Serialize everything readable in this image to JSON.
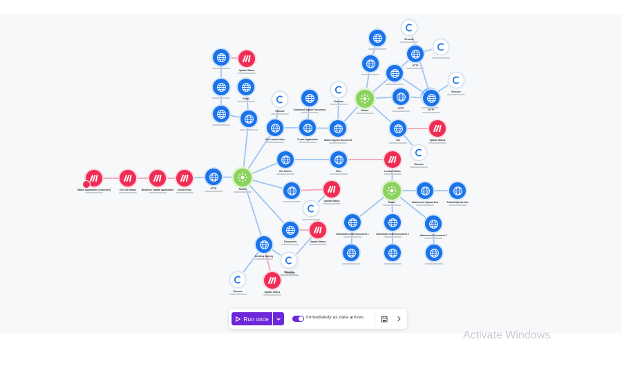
{
  "toolbar": {
    "run_label": "Run once",
    "schedule_label": "Immediately as data arrives",
    "schedule_on": true,
    "accent_color": "#6d28d9"
  },
  "watermark": "Activate Windows",
  "colors": {
    "http_module": "#1a73e8",
    "make_module": "#ef2e55",
    "router_module": "#8cd25f",
    "resume_module": "#ffffff"
  },
  "nodes": [
    {
      "id": "trigger",
      "type": "make",
      "label": "Watch Application (Searched)",
      "icon": "make-logo-icon"
    },
    {
      "id": "get_job",
      "type": "make",
      "label": "Get Job Status",
      "icon": "make-logo-icon"
    },
    {
      "id": "business",
      "type": "make",
      "label": "Business Capital Application",
      "icon": "make-logo-icon"
    },
    {
      "id": "create_entry",
      "type": "make",
      "label": "Create Entry",
      "icon": "make-logo-icon"
    },
    {
      "id": "http_main",
      "type": "http",
      "label": "HTTP",
      "icon": "globe-icon"
    },
    {
      "id": "router_main",
      "type": "router",
      "label": "Router",
      "icon": "router-icon"
    },
    {
      "id": "h1",
      "type": "http",
      "label": "",
      "icon": "globe-icon"
    },
    {
      "id": "upd1",
      "type": "make",
      "label": "Update Status",
      "icon": "make-logo-icon"
    },
    {
      "id": "h2",
      "type": "http",
      "label": "",
      "icon": "globe-icon"
    },
    {
      "id": "h3",
      "type": "http",
      "label": "Email",
      "icon": "globe-icon"
    },
    {
      "id": "h4",
      "type": "http",
      "label": "",
      "icon": "globe-icon"
    },
    {
      "id": "h5",
      "type": "http",
      "label": "",
      "icon": "globe-icon"
    },
    {
      "id": "res1",
      "type": "resume",
      "label": "Resume",
      "icon": "resume-icon"
    },
    {
      "id": "h6",
      "type": "http",
      "label": "Download Signed Document",
      "icon": "globe-icon"
    },
    {
      "id": "res2",
      "type": "resume",
      "label": "Resume",
      "icon": "resume-icon"
    },
    {
      "id": "h7",
      "type": "http",
      "label": "Get Lowest Value",
      "icon": "globe-icon"
    },
    {
      "id": "h8",
      "type": "http",
      "label": "Create Application",
      "icon": "globe-icon"
    },
    {
      "id": "h9",
      "type": "http",
      "label": "Attach Signed Document",
      "icon": "globe-icon"
    },
    {
      "id": "router_top",
      "type": "router",
      "label": "Router",
      "icon": "router-icon"
    },
    {
      "id": "h10",
      "type": "http",
      "label": "",
      "icon": "globe-icon"
    },
    {
      "id": "h11",
      "type": "http",
      "label": "",
      "icon": "globe-icon"
    },
    {
      "id": "res3",
      "type": "resume",
      "label": "",
      "icon": "resume-icon"
    },
    {
      "id": "h12",
      "type": "http",
      "label": "HTTP",
      "icon": "globe-icon"
    },
    {
      "id": "res4",
      "type": "resume",
      "label": "Resume",
      "icon": "resume-icon"
    },
    {
      "id": "h13",
      "type": "http",
      "label": "",
      "icon": "globe-icon"
    },
    {
      "id": "h14",
      "type": "http",
      "label": "",
      "icon": "globe-icon"
    },
    {
      "id": "h15",
      "type": "http",
      "label": "HTTP",
      "icon": "globe-icon"
    },
    {
      "id": "h16",
      "type": "http",
      "label": "HTTP",
      "icon": "globe-icon"
    },
    {
      "id": "res5",
      "type": "resume",
      "label": "Resume",
      "icon": "resume-icon"
    },
    {
      "id": "h17",
      "type": "http",
      "label": "Get",
      "icon": "globe-icon"
    },
    {
      "id": "upd2",
      "type": "make",
      "label": "Update Status",
      "icon": "make-logo-icon"
    },
    {
      "id": "res6",
      "type": "resume",
      "label": "Resume",
      "icon": "resume-icon"
    },
    {
      "id": "h18",
      "type": "http",
      "label": "Get Tokens",
      "icon": "globe-icon"
    },
    {
      "id": "h19",
      "type": "http",
      "label": "Files",
      "icon": "globe-icon"
    },
    {
      "id": "lookup",
      "type": "make",
      "label": "Lookup Status",
      "icon": "make-logo-icon"
    },
    {
      "id": "h20",
      "type": "http",
      "label": "",
      "icon": "globe-icon"
    },
    {
      "id": "upd3",
      "type": "make",
      "label": "Update Status",
      "icon": "make-logo-icon"
    },
    {
      "id": "res7",
      "type": "resume",
      "label": "",
      "icon": "resume-icon"
    },
    {
      "id": "router_mid",
      "type": "router",
      "label": "Router",
      "icon": "router-icon"
    },
    {
      "id": "h21",
      "type": "http",
      "label": "Attachment Upload Doc",
      "icon": "globe-icon"
    },
    {
      "id": "h22",
      "type": "http",
      "label": "Submit Upload Doc",
      "icon": "globe-icon"
    },
    {
      "id": "h23",
      "type": "http",
      "label": "Download Credit Document 1",
      "icon": "globe-icon"
    },
    {
      "id": "h24",
      "type": "http",
      "label": "Download Credit Document 2",
      "icon": "globe-icon"
    },
    {
      "id": "h25",
      "type": "http",
      "label": "Attachment Document 3",
      "icon": "globe-icon"
    },
    {
      "id": "h26",
      "type": "http",
      "label": "",
      "icon": "globe-icon"
    },
    {
      "id": "h27",
      "type": "http",
      "label": "",
      "icon": "globe-icon"
    },
    {
      "id": "h28",
      "type": "http",
      "label": "",
      "icon": "globe-icon"
    },
    {
      "id": "h29",
      "type": "http",
      "label": "Documents",
      "icon": "globe-icon"
    },
    {
      "id": "upd4",
      "type": "make",
      "label": "Update Status",
      "icon": "make-logo-icon"
    },
    {
      "id": "res8",
      "type": "resume",
      "label": "Resume",
      "icon": "resume-icon"
    },
    {
      "id": "h30",
      "type": "http",
      "label": "Sending Agency",
      "icon": "globe-icon"
    },
    {
      "id": "res9",
      "type": "resume",
      "label": "Resume",
      "icon": "resume-icon"
    },
    {
      "id": "res10",
      "type": "resume",
      "label": "Resume",
      "icon": "resume-icon"
    },
    {
      "id": "upd5",
      "type": "make",
      "label": "Update Status",
      "icon": "make-logo-icon"
    }
  ],
  "edges": [
    [
      "trigger",
      "get_job"
    ],
    [
      "get_job",
      "business"
    ],
    [
      "business",
      "create_entry"
    ],
    [
      "create_entry",
      "http_main"
    ],
    [
      "http_main",
      "router_main"
    ],
    [
      "h1",
      "upd1"
    ],
    [
      "h1",
      "h2"
    ],
    [
      "h2",
      "h4"
    ],
    [
      "h4",
      "h5"
    ],
    [
      "h3",
      "h5"
    ],
    [
      "h5",
      "router_main"
    ],
    [
      "router_main",
      "h7"
    ],
    [
      "h7",
      "h8"
    ],
    [
      "h8",
      "h9"
    ],
    [
      "h6",
      "h8"
    ],
    [
      "res1",
      "h7"
    ],
    [
      "res2",
      "h9"
    ],
    [
      "h9",
      "router_top"
    ],
    [
      "router_top",
      "h11"
    ],
    [
      "h11",
      "h10"
    ],
    [
      "router_top",
      "h13"
    ],
    [
      "h13",
      "h12"
    ],
    [
      "h12",
      "res3"
    ],
    [
      "router_top",
      "h15"
    ],
    [
      "h15",
      "h16"
    ],
    [
      "h16",
      "res5"
    ],
    [
      "h14",
      "h13"
    ],
    [
      "res4",
      "h14"
    ],
    [
      "router_top",
      "h17"
    ],
    [
      "h17",
      "upd2"
    ],
    [
      "h17",
      "res6"
    ],
    [
      "router_main",
      "h18"
    ],
    [
      "h18",
      "h19"
    ],
    [
      "h19",
      "lookup"
    ],
    [
      "lookup",
      "router_mid"
    ],
    [
      "router_main",
      "h20"
    ],
    [
      "h20",
      "upd3"
    ],
    [
      "upd3",
      "res7"
    ],
    [
      "router_mid",
      "h21"
    ],
    [
      "h21",
      "h22"
    ],
    [
      "router_mid",
      "h23"
    ],
    [
      "h23",
      "h26"
    ],
    [
      "router_mid",
      "h24"
    ],
    [
      "h24",
      "h27"
    ],
    [
      "router_mid",
      "h25"
    ],
    [
      "h25",
      "h28"
    ],
    [
      "router_main",
      "h29"
    ],
    [
      "h29",
      "upd4"
    ],
    [
      "upd4",
      "res8"
    ],
    [
      "router_main",
      "h30"
    ],
    [
      "h30",
      "res9"
    ],
    [
      "h30",
      "res10"
    ],
    [
      "h30",
      "upd5"
    ]
  ]
}
